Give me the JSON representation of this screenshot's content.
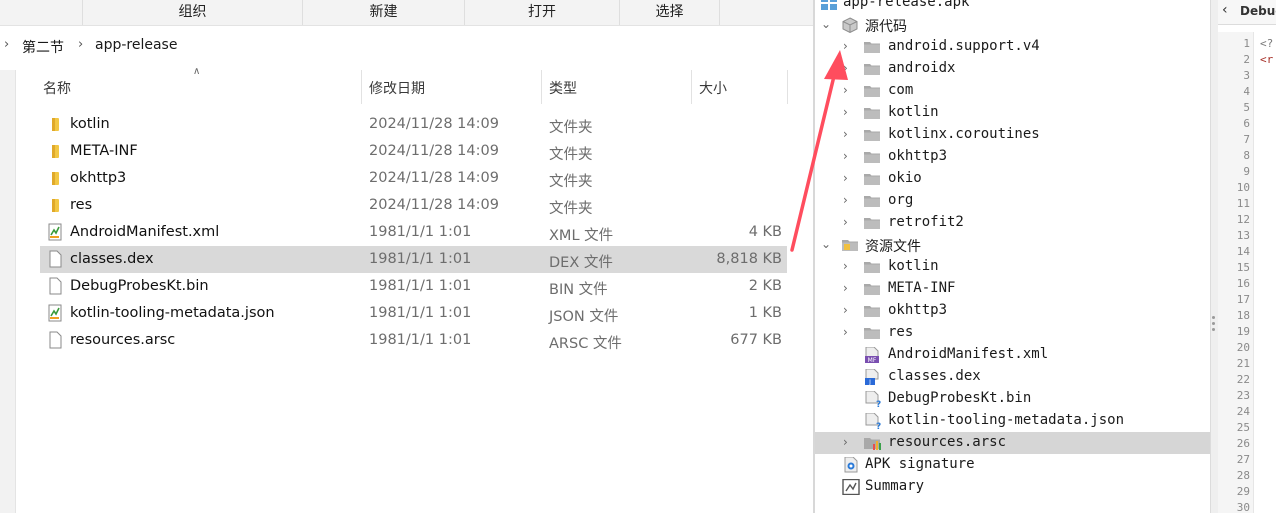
{
  "explorer": {
    "ribbon": [
      {
        "label": "组织"
      },
      {
        "label": "新建"
      },
      {
        "label": "打开"
      },
      {
        "label": "选择"
      }
    ],
    "breadcrumb": [
      "第二节",
      "app-release"
    ],
    "columns": {
      "name": "名称",
      "modified": "修改日期",
      "type": "类型",
      "size": "大小"
    },
    "files": [
      {
        "name": "kotlin",
        "modified": "2024/11/28 14:09",
        "type": "文件夹",
        "size": "",
        "icon": "folder-icon"
      },
      {
        "name": "META-INF",
        "modified": "2024/11/28 14:09",
        "type": "文件夹",
        "size": "",
        "icon": "folder-icon"
      },
      {
        "name": "okhttp3",
        "modified": "2024/11/28 14:09",
        "type": "文件夹",
        "size": "",
        "icon": "folder-icon"
      },
      {
        "name": "res",
        "modified": "2024/11/28 14:09",
        "type": "文件夹",
        "size": "",
        "icon": "folder-icon"
      },
      {
        "name": "AndroidManifest.xml",
        "modified": "1981/1/1 1:01",
        "type": "XML 文件",
        "size": "4 KB",
        "icon": "xml-file-icon"
      },
      {
        "name": "classes.dex",
        "modified": "1981/1/1 1:01",
        "type": "DEX 文件",
        "size": "8,818 KB",
        "icon": "file-icon",
        "selected": true
      },
      {
        "name": "DebugProbesKt.bin",
        "modified": "1981/1/1 1:01",
        "type": "BIN 文件",
        "size": "2 KB",
        "icon": "file-icon"
      },
      {
        "name": "kotlin-tooling-metadata.json",
        "modified": "1981/1/1 1:01",
        "type": "JSON 文件",
        "size": "1 KB",
        "icon": "json-file-icon"
      },
      {
        "name": "resources.arsc",
        "modified": "1981/1/1 1:01",
        "type": "ARSC 文件",
        "size": "677 KB",
        "icon": "file-icon"
      }
    ]
  },
  "tree": {
    "root": "app-release.apk",
    "source_label": "源代码",
    "packages": [
      "android.support.v4",
      "androidx",
      "com",
      "kotlin",
      "kotlinx.coroutines",
      "okhttp3",
      "okio",
      "org",
      "retrofit2"
    ],
    "resources_label": "资源文件",
    "resource_folders": [
      "kotlin",
      "META-INF",
      "okhttp3",
      "res"
    ],
    "resource_files": [
      {
        "name": "AndroidManifest.xml",
        "icon": "manifest-file-icon"
      },
      {
        "name": "classes.dex",
        "icon": "java-file-icon"
      },
      {
        "name": "DebugProbesKt.bin",
        "icon": "unknown-file-icon"
      },
      {
        "name": "kotlin-tooling-metadata.json",
        "icon": "unknown-file-icon"
      },
      {
        "name": "resources.arsc",
        "icon": "arsc-file-icon",
        "selected": true,
        "expandable": true
      }
    ],
    "apk_signature": "APK signature",
    "summary": "Summary"
  },
  "code": {
    "tab_title": "Debug",
    "line_numbers": [
      "1",
      "2",
      "3",
      "4",
      "5",
      "6",
      "7",
      "8",
      "9",
      "10",
      "11",
      "12",
      "13",
      "14",
      "15",
      "16",
      "17",
      "18",
      "19",
      "20",
      "21",
      "22",
      "23",
      "24",
      "25",
      "26",
      "27",
      "28",
      "29",
      "30"
    ],
    "lines": [
      "<?",
      "<r"
    ]
  },
  "colors": {
    "arrow": "#ff4d5e",
    "selection_row": "#d9d9d9",
    "folder": "#f2c744"
  }
}
